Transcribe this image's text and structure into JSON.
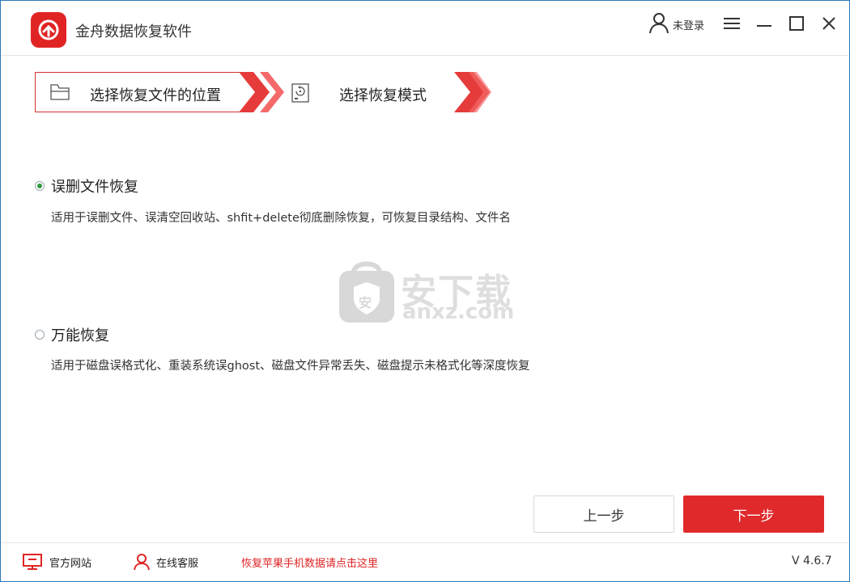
{
  "app": {
    "title": "金舟数据恢复软件",
    "brand_color": "#e02424"
  },
  "header": {
    "user_label": "未登录",
    "icons": [
      "user-icon",
      "menu-icon",
      "minimize-icon",
      "maximize-icon",
      "close-icon"
    ]
  },
  "steps": [
    {
      "label": "选择恢复文件的位置",
      "icon": "folder-icon"
    },
    {
      "label": "选择恢复模式",
      "icon": "disk-restore-icon"
    }
  ],
  "options": [
    {
      "label": "误删文件恢复",
      "desc": "适用于误删文件、误清空回收站、shfit+delete彻底删除恢复，可恢复目录结构、文件名",
      "checked": true
    },
    {
      "label": "万能恢复",
      "desc": "适用于磁盘误格式化、重装系统误ghost、磁盘文件异常丢失、磁盘提示未格式化等深度恢复",
      "checked": false
    }
  ],
  "watermark": {
    "cn": "安下载",
    "en": "anxz.com",
    "badge": "安"
  },
  "buttons": {
    "prev": "上一步",
    "next": "下一步"
  },
  "footer": {
    "website": "官方网站",
    "support": "在线客服",
    "promo": "恢复苹果手机数据请点击这里",
    "version": "V 4.6.7"
  }
}
